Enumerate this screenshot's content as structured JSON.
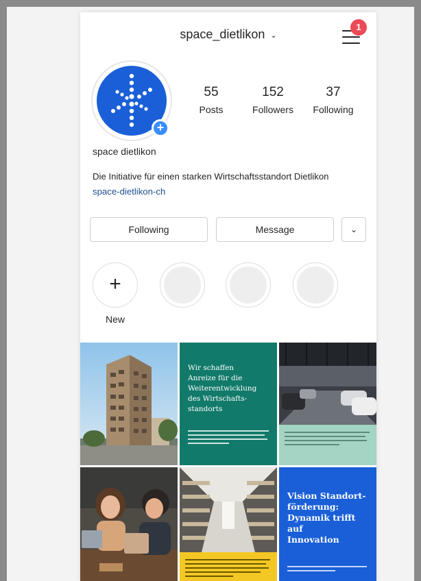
{
  "profile": {
    "username": "space_dietlikon",
    "display_name": "space dietlikon",
    "bio": "Die Initiative für einen starken Wirtschaftsstandort Dietlikon",
    "link": "space-dietlikon-ch",
    "notification_count": "1"
  },
  "stats": [
    {
      "value": "55",
      "label": "Posts"
    },
    {
      "value": "152",
      "label": "Followers"
    },
    {
      "value": "37",
      "label": "Following"
    }
  ],
  "buttons": {
    "following": "Following",
    "message": "Message"
  },
  "highlights": {
    "new_label": "New"
  },
  "posts": {
    "p2_title": "Wir schaffen\nAnreize für die\nWeiterentwicklung\ndes Wirtschafts-\nstandorts",
    "p6_title": "Vision Standort-\nförderung:\nDynamik trifft auf\nInnovation"
  },
  "colors": {
    "brand_blue": "#1a5fd8",
    "teal": "#127a6a",
    "mint": "#a4d4c3",
    "yellow": "#f4c824",
    "notification": "#ed4956"
  }
}
